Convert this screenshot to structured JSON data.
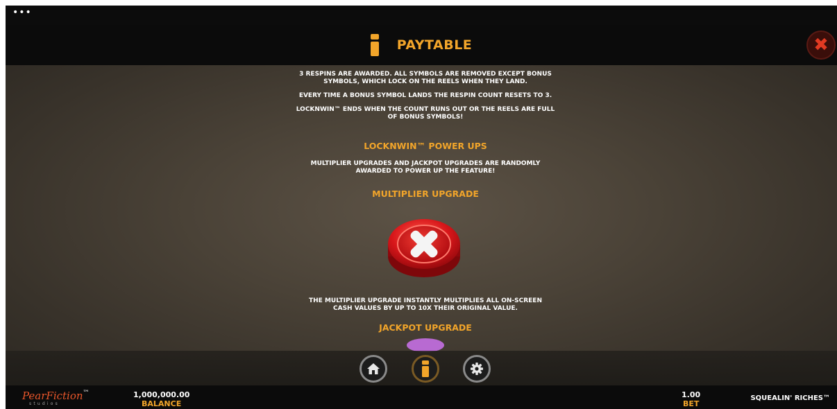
{
  "header": {
    "title": "PAYTABLE",
    "menu_dots": "•••",
    "close_symbol": "✖"
  },
  "content": {
    "paragraphs": [
      "3 RESPINS ARE AWARDED. ALL SYMBOLS ARE REMOVED EXCEPT BONUS SYMBOLS, WHICH LOCK ON THE REELS WHEN THEY LAND.",
      "EVERY TIME A BONUS SYMBOL LANDS THE RESPIN COUNT RESETS TO 3.",
      "LOCKNWIN™ ENDS WHEN THE COUNT RUNS OUT OR THE REELS ARE FULL OF BONUS SYMBOLS!"
    ],
    "powerups_heading": "LOCKNWIN™ POWER UPS",
    "powerups_text": "MULTIPLIER UPGRADES AND JACKPOT UPGRADES ARE RANDOMLY AWARDED TO POWER UP THE FEATURE!",
    "multiplier_heading": "MULTIPLIER UPGRADE",
    "multiplier_text": "THE MULTIPLIER UPGRADE INSTANTLY MULTIPLIES ALL ON-SCREEN CASH VALUES BY UP TO 10X THEIR ORIGINAL VALUE.",
    "jackpot_heading": "JACKPOT UPGRADE"
  },
  "nav": {
    "home_icon": "home-icon",
    "info_icon": "info-icon",
    "settings_icon": "gear-icon"
  },
  "footer": {
    "brand_name": "PearFiction",
    "brand_tm": "™",
    "brand_sub": "studios",
    "balance_value": "1,000,000.00",
    "balance_label": "BALANCE",
    "bet_value": "1.00",
    "bet_label": "BET",
    "game_name": "SQUEALIN' RICHES™"
  },
  "colors": {
    "accent": "#f2a52a",
    "close_red": "#e23a22",
    "brand_orange": "#e8562a",
    "chip_red": "#d8161a"
  }
}
